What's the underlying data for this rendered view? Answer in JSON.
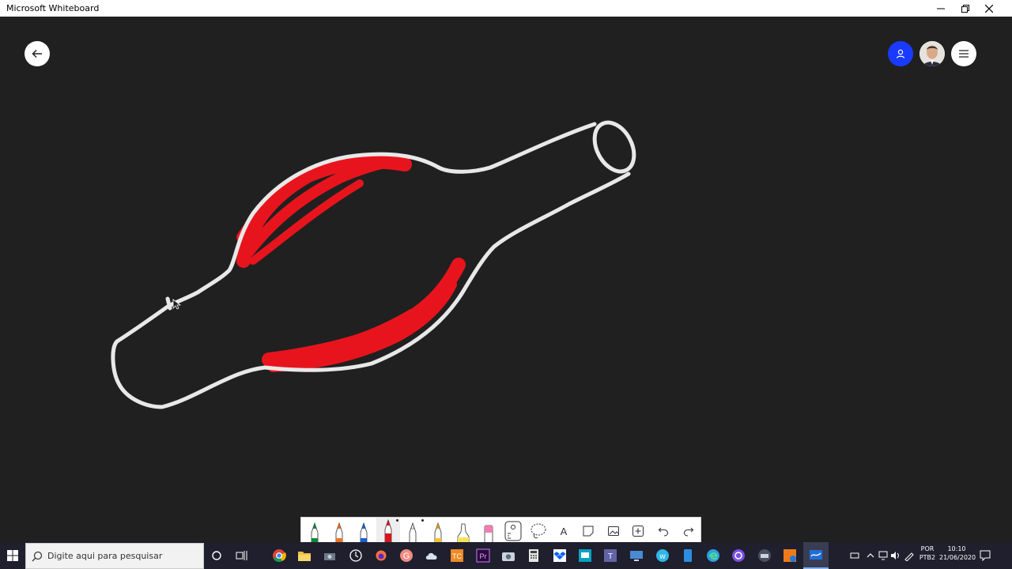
{
  "window": {
    "title": "Microsoft Whiteboard",
    "min_icon": "minimize-icon",
    "restore_icon": "restore-icon",
    "close_icon": "close-icon"
  },
  "canvas": {
    "background": "#202020",
    "ink_white": "#e8e8e8",
    "ink_red": "#e8141d"
  },
  "header": {
    "back_icon": "arrow-left-icon",
    "invite_icon": "person-icon",
    "menu_icon": "hamburger-icon",
    "invite_color": "#1a3bff"
  },
  "toolbar": {
    "tools": [
      "green-pen",
      "orange-pen",
      "blue-pen",
      "red-pen",
      "white-pen",
      "yellow-pencil",
      "highlighter",
      "eraser",
      "ruler",
      "lasso",
      "text",
      "note",
      "image",
      "insert",
      "undo",
      "redo"
    ],
    "text_tool_glyph": "A"
  },
  "taskbar": {
    "search_placeholder": "Digite aqui para pesquisar",
    "lang_1": "POR",
    "lang_2": "PTB2",
    "time": "10:10",
    "date": "21/06/2020"
  }
}
